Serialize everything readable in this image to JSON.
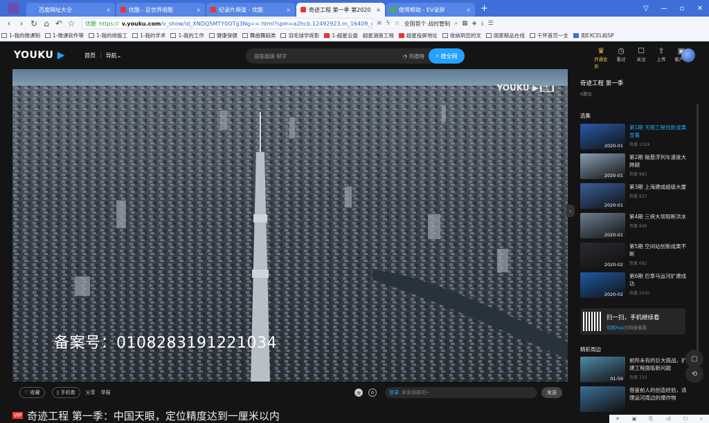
{
  "browser": {
    "tabs": [
      {
        "label": "百度网址大全"
      },
      {
        "label": "优酷 - 这世界很酷"
      },
      {
        "label": "纪录片频道 - 优酷"
      },
      {
        "label": "奇迹工程 第一季 第2020"
      },
      {
        "label": "使用帮助 - EV录屏"
      }
    ],
    "url_prefix": "优酷",
    "url_scheme": "https://",
    "url_host": "v.youku.com",
    "url_path": "/v_show/id_XNDQ5MTY0OTg3Ng==.html?spm=a2hcb.12492923.m_16409_c_60",
    "search_engine": "全国首个 战时管制",
    "bookmarks": [
      "1-我的微课制",
      "1-微课软件等",
      "1-我的排版工",
      "1-我的学术",
      "1-我的工作",
      "健康保健",
      "舞曲舞蹈类",
      "羽毛球学练影",
      "1-超星云盘",
      "超星湖南工程",
      "超星投屏地址",
      "收纳到您的文",
      "国家精品在线",
      "千怀首页一全",
      "用EXCEL和SP"
    ]
  },
  "header": {
    "logo_main": "YOUKU",
    "logo_accent": "▶",
    "nav_home": "首页",
    "nav_sep": "|",
    "nav_menu": "导航⌄",
    "search_placeholder": "丽医超级·郁字",
    "search_hot": "热搜榜",
    "search_button": "搜全网",
    "icons": [
      {
        "label": "开通会员",
        "glyph": "♛",
        "icon": "crown-icon"
      },
      {
        "label": "看过",
        "glyph": "◷",
        "icon": "history-icon"
      },
      {
        "label": "关注",
        "glyph": "☐",
        "icon": "bookmark-icon"
      },
      {
        "label": "上传",
        "glyph": "⇪",
        "icon": "upload-icon"
      },
      {
        "label": "客户端",
        "glyph": "▣",
        "icon": "client-icon"
      }
    ]
  },
  "player": {
    "watermark": "YOUKU ▶",
    "watermark_badge": "独播",
    "beian": "备案号：0108283191221034"
  },
  "controls": {
    "collect": "♡ 收藏",
    "phone": "▯ 手机看",
    "share": "分享",
    "report": "举报",
    "danmu_login": "登录",
    "danmu_placeholder": "来发弹幕吧~",
    "danmu_send": "发送"
  },
  "video_title": "奇迹工程 第一季：中国天眼，定位精度达到一厘米以内",
  "sidebar": {
    "show_title": "奇迹工程 第一季",
    "episode_count": "6期全",
    "section_episodes": "选集",
    "episodes": [
      {
        "name": "第1期 天眼工程创新成果显著",
        "date": "2020-01",
        "heat": "热度 1324",
        "color": "#2b5aa8"
      },
      {
        "name": "第2期 磁悬浮列车速度大跨越",
        "date": "2020-01",
        "heat": "热度 883",
        "color": "#8aa0b4"
      },
      {
        "name": "第3期 上海建成超级大厦",
        "date": "2020-01",
        "heat": "热度 837",
        "color": "#3a5f9a"
      },
      {
        "name": "第4期 三峡大坝阻断洪水",
        "date": "2020-01",
        "heat": "热度 846",
        "color": "#6e7f90"
      },
      {
        "name": "第5期 空间站创新成果不断",
        "date": "2020-02",
        "heat": "热度 692",
        "color": "#2a2a32"
      },
      {
        "name": "第6期 巴拿马运河扩建成功",
        "date": "2020-02",
        "heat": "热度 1030",
        "color": "#1e5aa6"
      }
    ],
    "qr_title": "扫一扫，手机继续看",
    "qr_app": "优酷App",
    "qr_sub": "扫码接着看",
    "section_around": "精彩周边",
    "around": [
      {
        "name": "前所未有的巨大挑战，扩建工程面临新问题",
        "duration": "01:59",
        "heat": "热度 723",
        "color": "#4f8aa8"
      },
      {
        "name": "借鉴前人的创造经验，清理运河周边的爆炸物",
        "duration": "",
        "heat": "",
        "color": "#3b6f96"
      }
    ]
  }
}
